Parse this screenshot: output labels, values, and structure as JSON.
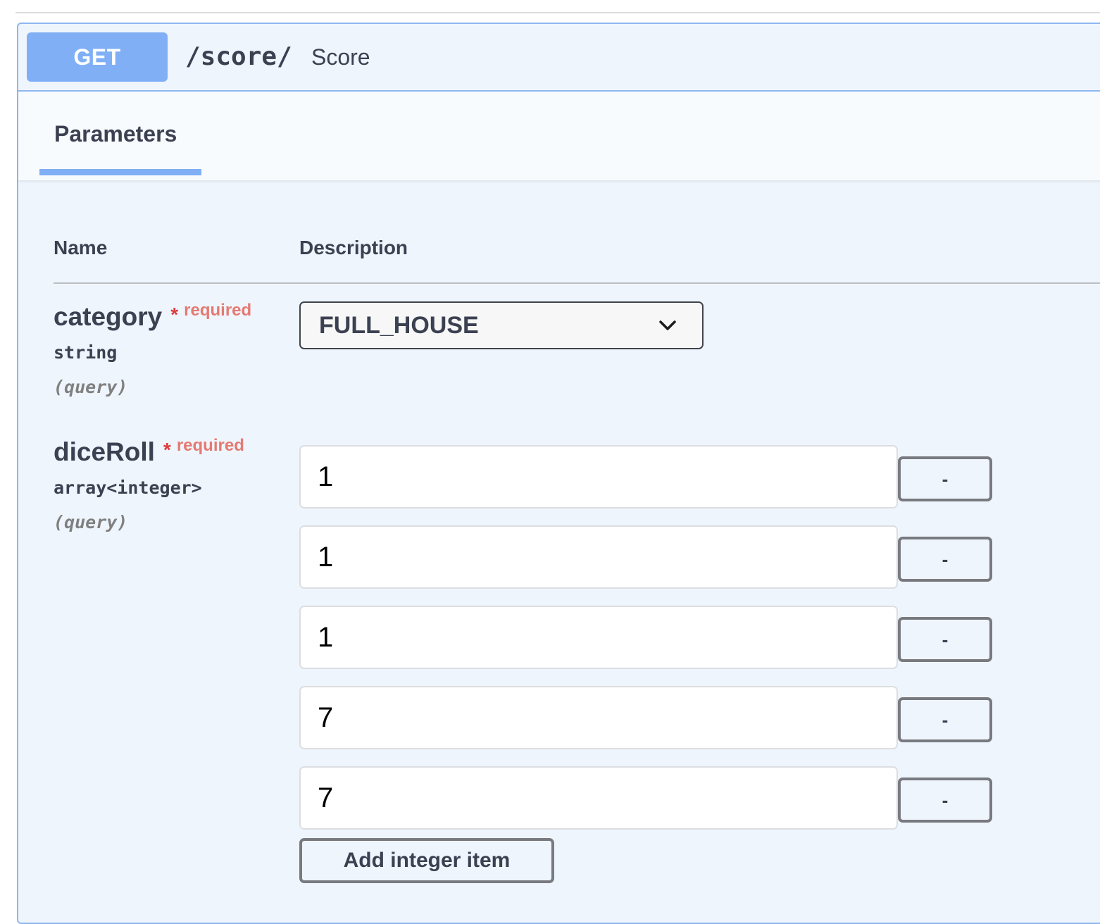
{
  "operation": {
    "method": "GET",
    "path": "/score/",
    "summary": "Score"
  },
  "tabs": [
    {
      "label": "Parameters",
      "active": true
    }
  ],
  "table": {
    "headers": {
      "name": "Name",
      "description": "Description"
    }
  },
  "parameters": {
    "category": {
      "name": "category",
      "asterisk": "*",
      "required_label": "required",
      "type": "string",
      "location": "(query)",
      "selected": "FULL_HOUSE",
      "icon": "chevron-down-icon"
    },
    "diceRoll": {
      "name": "diceRoll",
      "asterisk": "*",
      "required_label": "required",
      "type": "array<integer>",
      "location": "(query)",
      "items": [
        "1",
        "1",
        "1",
        "7",
        "7"
      ],
      "remove_label": "-",
      "add_label": "Add integer item"
    }
  },
  "colors": {
    "accent": "#80aff6",
    "block_bg": "#eff5fd",
    "block_border": "#8fb7ef",
    "required": "#e47a72",
    "asterisk": "#dc3d3d",
    "text": "#3b4151"
  }
}
